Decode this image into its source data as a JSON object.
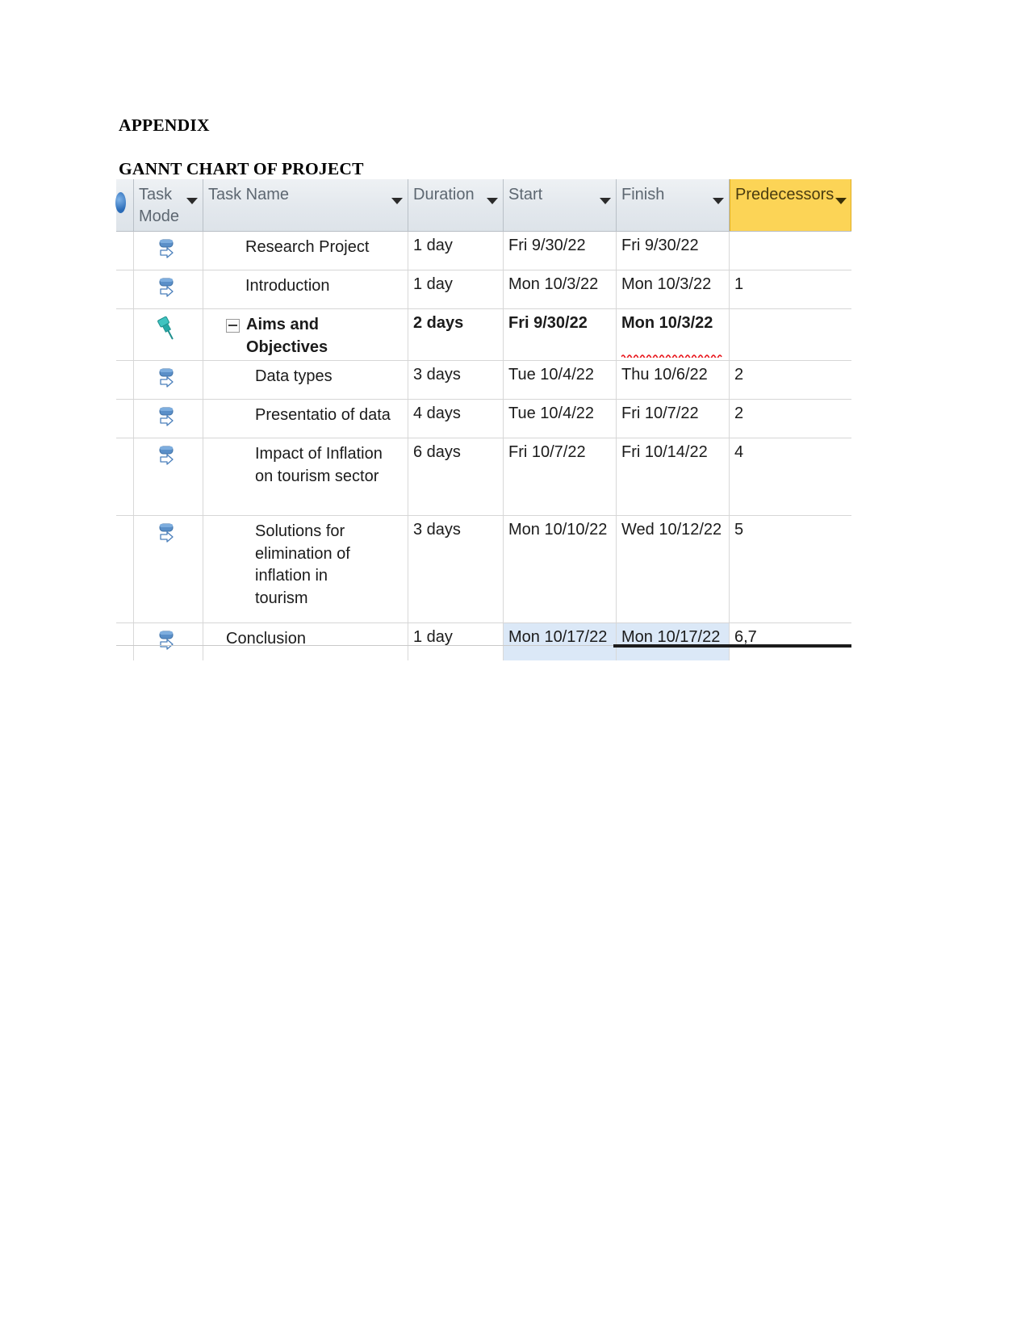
{
  "document": {
    "appendix_heading": "APPENDIX",
    "gantt_heading": "GANNT CHART OF PROJECT"
  },
  "table": {
    "columns": [
      {
        "key": "indicator",
        "label": ""
      },
      {
        "key": "task_mode",
        "label": "Task Mode"
      },
      {
        "key": "task_name",
        "label": "Task Name"
      },
      {
        "key": "duration",
        "label": "Duration"
      },
      {
        "key": "start",
        "label": "Start"
      },
      {
        "key": "finish",
        "label": "Finish"
      },
      {
        "key": "predecessors",
        "label": "Predecessors"
      }
    ],
    "header_highlight_color": "#FCD456",
    "selection_color": "#DBE8F7",
    "rows": [
      {
        "task_mode_icon": "auto-schedule-icon",
        "task_name": "Research Project",
        "duration": "1 day",
        "start": "Fri 9/30/22",
        "finish": "Fri 9/30/22",
        "predecessors": ""
      },
      {
        "task_mode_icon": "auto-schedule-icon",
        "task_name": "Introduction",
        "duration": "1 day",
        "start": "Mon 10/3/22",
        "finish": "Mon 10/3/22",
        "predecessors": "1"
      },
      {
        "task_mode_icon": "manual-schedule-pin-icon",
        "task_name": "Aims and Objectives",
        "duration": "2 days",
        "start": "Fri 9/30/22",
        "finish": "Mon 10/3/22",
        "predecessors": ""
      },
      {
        "task_mode_icon": "auto-schedule-icon",
        "task_name": "Data types",
        "duration": "3 days",
        "start": "Tue 10/4/22",
        "finish": "Thu 10/6/22",
        "predecessors": "2"
      },
      {
        "task_mode_icon": "auto-schedule-icon",
        "task_name": "Presentatio of data",
        "duration": "4 days",
        "start": "Tue 10/4/22",
        "finish": "Fri 10/7/22",
        "predecessors": "2"
      },
      {
        "task_mode_icon": "auto-schedule-icon",
        "task_name": "Impact of Inflation on tourism sector",
        "duration": "6 days",
        "start": "Fri 10/7/22",
        "finish": "Fri 10/14/22",
        "predecessors": "4"
      },
      {
        "task_mode_icon": "auto-schedule-icon",
        "task_name": "Solutions for elimination of inflation in tourism",
        "duration": "3 days",
        "start": "Mon 10/10/22",
        "finish": "Wed 10/12/22",
        "predecessors": "5"
      },
      {
        "task_mode_icon": "auto-schedule-icon",
        "task_name": "Conclusion",
        "duration": "1 day",
        "start": "Mon 10/17/22",
        "finish": "Mon 10/17/22",
        "predecessors": "6,7"
      }
    ]
  }
}
